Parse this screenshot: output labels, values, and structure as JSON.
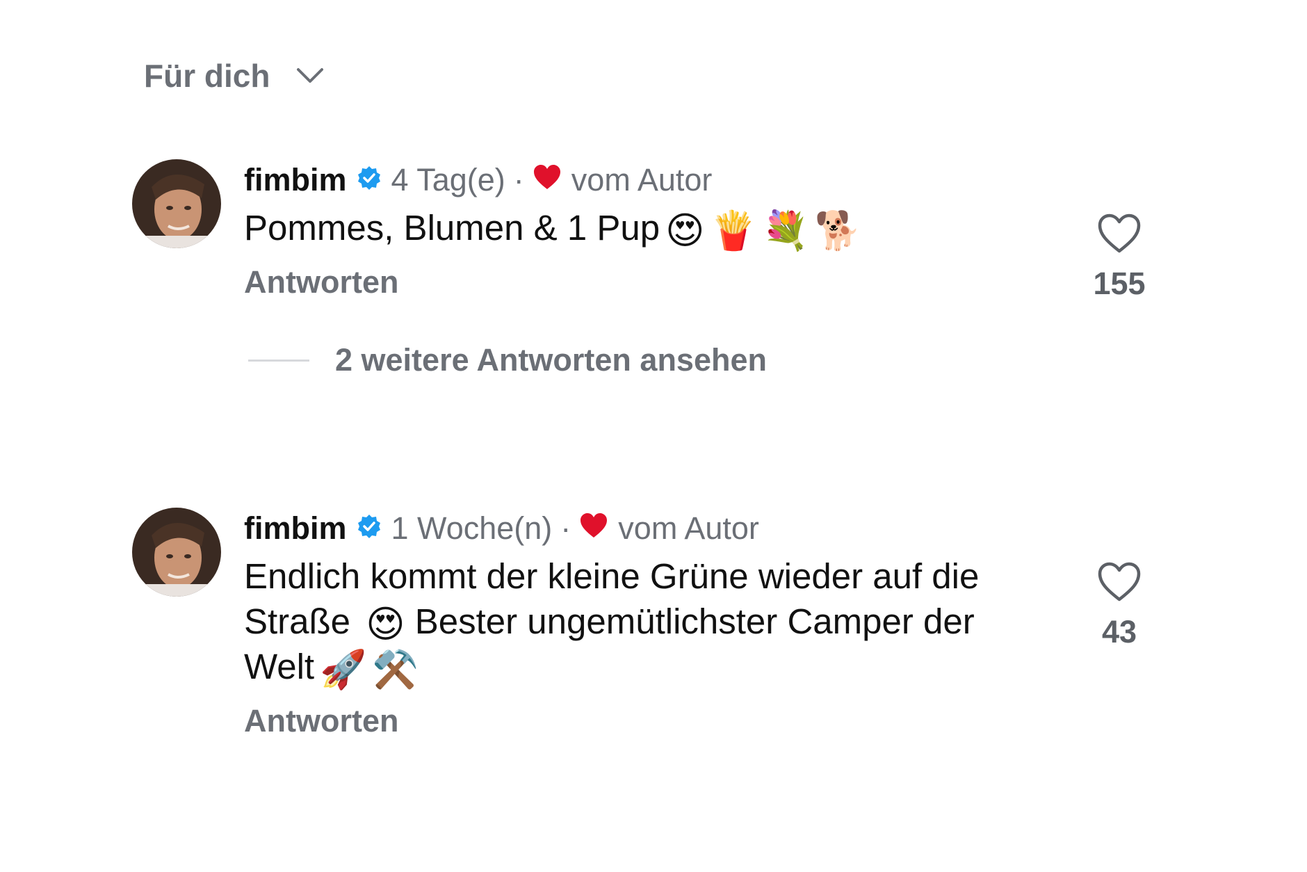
{
  "header": {
    "sort_label": "Für dich",
    "sort_icon": "chevron-down-icon"
  },
  "comments": [
    {
      "username": "fimbim",
      "verified_icon": "verified-badge-icon",
      "time": "4 Tag(e)",
      "separator": "·",
      "author_heart_icon": "red-heart-icon",
      "author_label": "vom Autor",
      "text": "Pommes, Blumen & 1 Pup",
      "emojis": [
        "😍",
        "🍟",
        "💐",
        "🐕"
      ],
      "reply_label": "Antworten",
      "like_icon": "heart-outline-icon",
      "like_count": "155",
      "more_replies": "2 weitere Antworten ansehen"
    },
    {
      "username": "fimbim",
      "verified_icon": "verified-badge-icon",
      "time": "1 Woche(n)",
      "separator": "·",
      "author_heart_icon": "red-heart-icon",
      "author_label": "vom Autor",
      "text_part1": "Endlich kommt der kleine Grüne wieder auf die Straße",
      "emoji_mid": "😍",
      "text_part2": "Bester ungemütlichster Camper der Welt",
      "emojis_end": [
        "🚀",
        "⚒️"
      ],
      "reply_label": "Antworten",
      "like_icon": "heart-outline-icon",
      "like_count": "43"
    }
  ],
  "colors": {
    "verified_blue": "#1d9bf0",
    "author_heart_red": "#e0112b",
    "secondary_text": "#6b6f76"
  }
}
